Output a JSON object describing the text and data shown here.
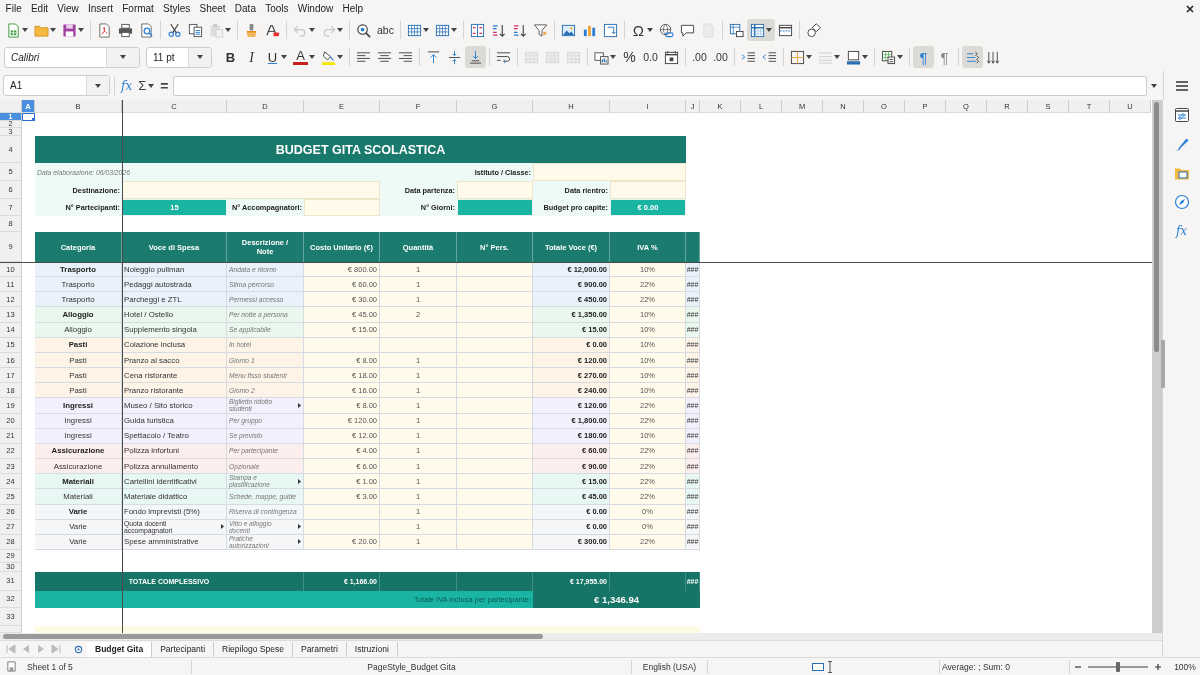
{
  "menu_bar": [
    "File",
    "Edit",
    "View",
    "Insert",
    "Format",
    "Styles",
    "Sheet",
    "Data",
    "Tools",
    "Window",
    "Help"
  ],
  "standard_toolbar": [
    {
      "pressed": false,
      "disabled": false
    },
    {
      "pressed": false,
      "disabled": false
    },
    {
      "pressed": false,
      "disabled": false
    },
    {
      "pressed": false,
      "disabled": false
    },
    {
      "pressed": false,
      "disabled": false
    },
    {
      "pressed": false,
      "disabled": false
    },
    {
      "pressed": false,
      "disabled": false
    },
    {
      "pressed": false,
      "disabled": false
    },
    {
      "pressed": false,
      "disabled": true
    },
    {
      "pressed": false,
      "disabled": false
    },
    {
      "pressed": false,
      "disabled": false
    },
    {
      "pressed": false,
      "disabled": true
    },
    {
      "pressed": false,
      "disabled": true
    },
    {
      "pressed": false,
      "disabled": false
    },
    {
      "glyph": "abc",
      "pressed": false,
      "disabled": false
    },
    {
      "pressed": false,
      "disabled": false
    },
    {
      "pressed": false,
      "disabled": false
    },
    {
      "pressed": false,
      "disabled": false
    },
    {
      "pressed": false,
      "disabled": false
    },
    {
      "pressed": false,
      "disabled": false
    },
    {
      "pressed": false,
      "disabled": false
    },
    {
      "pressed": false,
      "disabled": false
    },
    {
      "pressed": false,
      "disabled": false
    },
    {
      "pressed": false,
      "disabled": false
    },
    {
      "glyph": "Ω",
      "pressed": false,
      "disabled": false
    },
    {
      "pressed": false,
      "disabled": false
    },
    {
      "pressed": false,
      "disabled": false
    },
    {
      "pressed": false,
      "disabled": true
    },
    {
      "pressed": false,
      "disabled": false
    },
    {
      "pressed": true,
      "disabled": false
    },
    {
      "pressed": false,
      "disabled": false
    },
    {
      "pressed": false,
      "disabled": false
    }
  ],
  "formatting_toolbar": {
    "font_name": "Calibri",
    "font_size": "11 pt",
    "buttons": [
      {
        "glyph": "B",
        "pressed": false,
        "disabled": false
      },
      {
        "glyph": "I",
        "pressed": false,
        "disabled": false
      },
      {
        "glyph": "U",
        "pressed": false,
        "disabled": false
      },
      {
        "glyph": "A",
        "pressed": false,
        "disabled": false
      },
      {
        "pressed": false,
        "disabled": false
      },
      {
        "pressed": false,
        "disabled": false
      },
      {
        "pressed": false,
        "disabled": false
      },
      {
        "pressed": false,
        "disabled": false
      },
      {
        "pressed": false,
        "disabled": false
      },
      {
        "pressed": false,
        "disabled": false
      },
      {
        "pressed": true,
        "disabled": false
      },
      {
        "pressed": false,
        "disabled": false
      },
      {
        "pressed": false,
        "disabled": true
      },
      {
        "pressed": false,
        "disabled": true
      },
      {
        "pressed": false,
        "disabled": true
      },
      {
        "pressed": false,
        "disabled": false
      },
      {
        "glyph": "%",
        "pressed": false,
        "disabled": false
      },
      {
        "glyph": "0.0",
        "pressed": false,
        "disabled": false
      },
      {
        "pressed": false,
        "disabled": false
      },
      {
        "glyph": ".00",
        "pressed": false,
        "disabled": false
      },
      {
        "glyph": ".00",
        "pressed": false,
        "disabled": false
      },
      {
        "pressed": false,
        "disabled": false
      },
      {
        "pressed": false,
        "disabled": false
      },
      {
        "pressed": false,
        "disabled": false
      },
      {
        "pressed": false,
        "disabled": true
      },
      {
        "pressed": false,
        "disabled": false
      },
      {
        "pressed": false,
        "disabled": false
      },
      {
        "glyph": "¶",
        "pressed": true,
        "disabled": false
      },
      {
        "glyph": "¶",
        "pressed": false,
        "disabled": false
      },
      {
        "pressed": true,
        "disabled": false
      },
      {
        "pressed": false,
        "disabled": false
      }
    ]
  },
  "formula_bar": {
    "name_box": "A1",
    "function_wizard": "fx",
    "sum": "Σ",
    "formula": "="
  },
  "sidebar": {
    "functions": "fx"
  },
  "column_headers": [
    {
      "label": "A",
      "selected": true
    },
    {
      "label": "B",
      "selected": false
    },
    {
      "label": "C",
      "selected": false
    },
    {
      "label": "D",
      "selected": false
    },
    {
      "label": "E",
      "selected": false
    },
    {
      "label": "F",
      "selected": false
    },
    {
      "label": "G",
      "selected": false
    },
    {
      "label": "H",
      "selected": false
    },
    {
      "label": "I",
      "selected": false
    },
    {
      "label": "J",
      "selected": false
    },
    {
      "label": "K",
      "selected": false
    },
    {
      "label": "L",
      "selected": false
    },
    {
      "label": "M",
      "selected": false
    },
    {
      "label": "N",
      "selected": false
    },
    {
      "label": "O",
      "selected": false
    },
    {
      "label": "P",
      "selected": false
    },
    {
      "label": "Q",
      "selected": false
    },
    {
      "label": "R",
      "selected": false
    },
    {
      "label": "S",
      "selected": false
    },
    {
      "label": "T",
      "selected": false
    },
    {
      "label": "U",
      "selected": false
    }
  ],
  "row_headers": [
    {
      "label": "1",
      "selected": true
    },
    {
      "label": "2",
      "selected": false
    },
    {
      "label": "3",
      "selected": false
    },
    {
      "label": "4",
      "selected": false
    },
    {
      "label": "5",
      "selected": false
    },
    {
      "label": "6",
      "selected": false
    },
    {
      "label": "7",
      "selected": false
    },
    {
      "label": "8",
      "selected": false
    },
    {
      "label": "9",
      "selected": false
    },
    {
      "label": "10",
      "selected": false
    },
    {
      "label": "11",
      "selected": false
    },
    {
      "label": "12",
      "selected": false
    },
    {
      "label": "13",
      "selected": false
    },
    {
      "label": "14",
      "selected": false
    },
    {
      "label": "15",
      "selected": false
    },
    {
      "label": "16",
      "selected": false
    },
    {
      "label": "17",
      "selected": false
    },
    {
      "label": "18",
      "selected": false
    },
    {
      "label": "19",
      "selected": false
    },
    {
      "label": "20",
      "selected": false
    },
    {
      "label": "21",
      "selected": false
    },
    {
      "label": "22",
      "selected": false
    },
    {
      "label": "23",
      "selected": false
    },
    {
      "label": "24",
      "selected": false
    },
    {
      "label": "25",
      "selected": false
    },
    {
      "label": "26",
      "selected": false
    },
    {
      "label": "27",
      "selected": false
    },
    {
      "label": "28",
      "selected": false
    },
    {
      "label": "29",
      "selected": false
    },
    {
      "label": "30",
      "selected": false
    },
    {
      "label": "31",
      "selected": false
    },
    {
      "label": "32",
      "selected": false
    },
    {
      "label": "33",
      "selected": false
    }
  ],
  "sheet": {
    "title": "BUDGET GITA SCOLASTICA",
    "date_note": "Data elaborazione: 06/03/2026",
    "institute_label": "Istituto / Classe:",
    "destination_label": "Destinazione:",
    "departure_label": "Data partenza:",
    "return_label": "Data rientro:",
    "participants_label": "N° Partecipanti:",
    "participants": "15",
    "companions_label": "N° Accompagnatori:",
    "days_label": "N° Giorni:",
    "per_capita_label": "Budget pro capite:",
    "per_capita": "€ 0.00"
  },
  "table": {
    "columns": [
      "Categoria",
      "Voce di Spesa",
      "Descrizione / Note",
      "Costo Unitario (€)",
      "Quantità",
      "N° Pers.",
      "Totale Voce (€)",
      "IVA %"
    ],
    "rows": [
      {
        "category": "Trasporto",
        "bold": true,
        "color": "#e9f1fb",
        "item": "Noleggio pullman",
        "item_clipped": false,
        "note": "Andata e ritorno",
        "note_clipped": false,
        "unit_cost": "€ 800.00",
        "quantity": "1",
        "total": "€ 12,000.00",
        "vat": "10%",
        "column_j": "###"
      },
      {
        "category": "Trasporto",
        "bold": false,
        "color": "#e9f1fb",
        "item": "Pedaggi autostrada",
        "item_clipped": false,
        "note": "Stima percorso",
        "note_clipped": false,
        "unit_cost": "€ 60.00",
        "quantity": "1",
        "total": "€ 900.00",
        "vat": "22%",
        "column_j": "###"
      },
      {
        "category": "Trasporto",
        "bold": false,
        "color": "#e9f1fb",
        "item": "Parcheggi e ZTL",
        "item_clipped": false,
        "note": "Permessi accesso",
        "note_clipped": false,
        "unit_cost": "€ 30.00",
        "quantity": "1",
        "total": "€ 450.00",
        "vat": "22%",
        "column_j": "###"
      },
      {
        "category": "Alloggio",
        "bold": true,
        "color": "#eaf7ee",
        "item": "Hotel / Ostello",
        "item_clipped": false,
        "note": "Per notte a persona",
        "note_clipped": false,
        "unit_cost": "€ 45.00",
        "quantity": "2",
        "total": "€ 1,350.00",
        "vat": "10%",
        "column_j": "###"
      },
      {
        "category": "Alloggio",
        "bold": false,
        "color": "#eaf7ee",
        "item": "Supplemento singola",
        "item_clipped": false,
        "note": "Se applicabile",
        "note_clipped": false,
        "unit_cost": "€ 15.00",
        "total": "€ 15.00",
        "vat": "10%",
        "column_j": "###"
      },
      {
        "category": "Pasti",
        "bold": true,
        "color": "#fdf3e7",
        "item": "Colazione inclusa",
        "item_clipped": false,
        "note": "In hotel",
        "note_clipped": false,
        "total": "€ 0.00",
        "vat": "10%",
        "column_j": "###"
      },
      {
        "category": "Pasti",
        "bold": false,
        "color": "#fdf3e7",
        "item": "Pranzo al sacco",
        "item_clipped": false,
        "note": "Giorno 1",
        "note_clipped": false,
        "unit_cost": "€ 8.00",
        "quantity": "1",
        "total": "€ 120.00",
        "vat": "10%",
        "column_j": "###"
      },
      {
        "category": "Pasti",
        "bold": false,
        "color": "#fdf3e7",
        "item": "Cena ristorante",
        "item_clipped": false,
        "note": "Menu fisso studenti",
        "note_clipped": false,
        "unit_cost": "€ 18.00",
        "quantity": "1",
        "total": "€ 270.00",
        "vat": "10%",
        "column_j": "###"
      },
      {
        "category": "Pasti",
        "bold": false,
        "color": "#fdf3e7",
        "item": "Pranzo ristorante",
        "item_clipped": false,
        "note": "Giorno 2",
        "note_clipped": false,
        "unit_cost": "€ 16.00",
        "quantity": "1",
        "total": "€ 240.00",
        "vat": "10%",
        "column_j": "###"
      },
      {
        "category": "Ingressi",
        "bold": true,
        "color": "#f1f0fc",
        "item": "Museo / Sito storico",
        "item_clipped": false,
        "note": "Biglietto ridotto studenti",
        "note_clipped": true,
        "unit_cost": "€ 8.00",
        "quantity": "1",
        "total": "€ 120.00",
        "vat": "22%",
        "column_j": "###"
      },
      {
        "category": "Ingressi",
        "bold": false,
        "color": "#f1f0fc",
        "item": "Guida turistica",
        "item_clipped": false,
        "note": "Per gruppo",
        "note_clipped": false,
        "unit_cost": "€ 120.00",
        "quantity": "1",
        "total": "€ 1,800.00",
        "vat": "22%",
        "column_j": "###"
      },
      {
        "category": "Ingressi",
        "bold": false,
        "color": "#f1f0fc",
        "item": "Spettacolo / Teatro",
        "item_clipped": false,
        "note": "Se previsto",
        "note_clipped": false,
        "unit_cost": "€ 12.00",
        "quantity": "1",
        "total": "€ 180.00",
        "vat": "10%",
        "column_j": "###"
      },
      {
        "category": "Assicurazione",
        "bold": true,
        "color": "#fdeeee",
        "item": "Polizza infortuni",
        "item_clipped": false,
        "note": "Per partecipante",
        "note_clipped": false,
        "unit_cost": "€ 4.00",
        "quantity": "1",
        "total": "€ 60.00",
        "vat": "22%",
        "column_j": "###"
      },
      {
        "category": "Assicurazione",
        "bold": false,
        "color": "#fdeeee",
        "item": "Polizza annullamento",
        "item_clipped": false,
        "note": "Opzionale",
        "note_clipped": false,
        "unit_cost": "€ 6.00",
        "quantity": "1",
        "total": "€ 90.00",
        "vat": "22%",
        "column_j": "###"
      },
      {
        "category": "Materiali",
        "bold": true,
        "color": "#e7f7f3",
        "item": "Cartellini identificativi",
        "item_clipped": false,
        "note": "Stampa e plastificazione",
        "note_clipped": true,
        "unit_cost": "€ 1.00",
        "quantity": "1",
        "total": "€ 15.00",
        "vat": "22%",
        "column_j": "###"
      },
      {
        "category": "Materiali",
        "bold": false,
        "color": "#e7f7f3",
        "item": "Materiale didattico",
        "item_clipped": false,
        "note": "Schede, mappe, guide",
        "note_clipped": false,
        "unit_cost": "€ 3.00",
        "quantity": "1",
        "total": "€ 45.00",
        "vat": "22%",
        "column_j": "###"
      },
      {
        "category": "Varie",
        "bold": true,
        "color": "#f5f6f8",
        "item": "Fondo imprevisti (5%)",
        "item_clipped": false,
        "note": "Riserva di contingenza",
        "note_clipped": false,
        "quantity": "1",
        "total": "€ 0.00",
        "vat": "0%",
        "column_j": "###"
      },
      {
        "category": "Varie",
        "bold": false,
        "color": "#f5f6f8",
        "item": "Quota docenti accompagnatori",
        "item_clipped": true,
        "note": "Vitto e alloggio docenti",
        "note_clipped": true,
        "quantity": "1",
        "total": "€ 0.00",
        "vat": "0%",
        "column_j": "###"
      },
      {
        "category": "Varie",
        "bold": false,
        "color": "#f5f6f8",
        "item": "Spese amministrative",
        "item_clipped": false,
        "note": "Pratiche autorizzazioni",
        "note_clipped": true,
        "unit_cost": "€ 20.00",
        "quantity": "1",
        "total": "€ 300.00",
        "vat": "22%",
        "column_j": "###"
      }
    ]
  },
  "totals": {
    "label": "TOTALE COMPLESSIVO",
    "unit_cost": "€ 1,166.00",
    "total": "€ 17,955.00",
    "column_j": "###"
  },
  "per_participant": {
    "label": "Totale IVA inclusa per partecipante:",
    "value": "€ 1,346.94"
  },
  "sheet_tabs": [
    {
      "label": "Budget Gita",
      "selected": true
    },
    {
      "label": "Partecipanti",
      "selected": false
    },
    {
      "label": "Riepilogo Spese",
      "selected": false
    },
    {
      "label": "Parametri",
      "selected": false
    },
    {
      "label": "Istruzioni",
      "selected": false
    }
  ],
  "status_bar": {
    "sheet": "Sheet 1 of 5",
    "page_style": "PageStyle_Budget Gita",
    "language": "English (USA)",
    "summary": "Average: ; Sum: 0",
    "zoom": {
      "level": 0.5,
      "reading": "100%"
    }
  }
}
